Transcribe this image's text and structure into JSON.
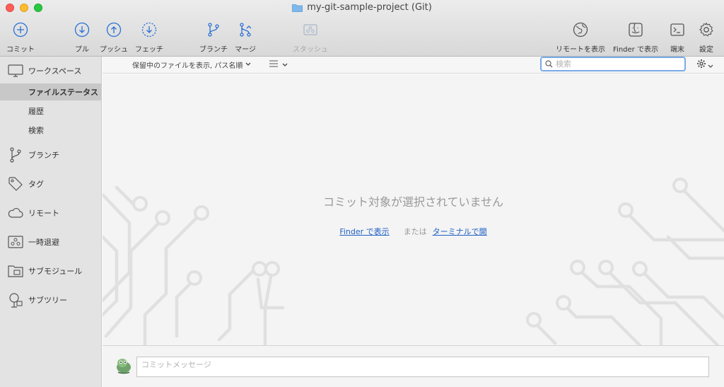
{
  "window": {
    "title": "my-git-sample-project (Git)"
  },
  "toolbar": {
    "commit": "コミット",
    "pull": "プル",
    "push": "プッシュ",
    "fetch": "フェッチ",
    "branch": "ブランチ",
    "merge": "マージ",
    "stash": "スタッシュ",
    "show_remote": "リモートを表示",
    "show_in_finder": "Finder で表示",
    "terminal": "端末",
    "settings": "設定"
  },
  "sidebar": {
    "workspace": "ワークスペース",
    "file_status": "ファイルステータス",
    "history": "履歴",
    "search": "検索",
    "branches": "ブランチ",
    "tags": "タグ",
    "remotes": "リモート",
    "stashes": "一時退避",
    "submodules": "サブモジュール",
    "subtrees": "サブツリー"
  },
  "filter_bar": {
    "filter_label": "保留中のファイルを表示, パス名順",
    "search_placeholder": "検索"
  },
  "content": {
    "empty_message": "コミット対象が選択されていません",
    "show_in_finder_link": "Finder で表示",
    "or_text": "または",
    "open_terminal_link": "ターミナルで開"
  },
  "commit": {
    "message_placeholder": "コミットメッセージ"
  },
  "colors": {
    "accent_blue": "#2a6fd6",
    "sidebar_bg": "#e3e3e3",
    "selected_item_bg": "#c8c8c8",
    "link": "#1f5fc4"
  }
}
